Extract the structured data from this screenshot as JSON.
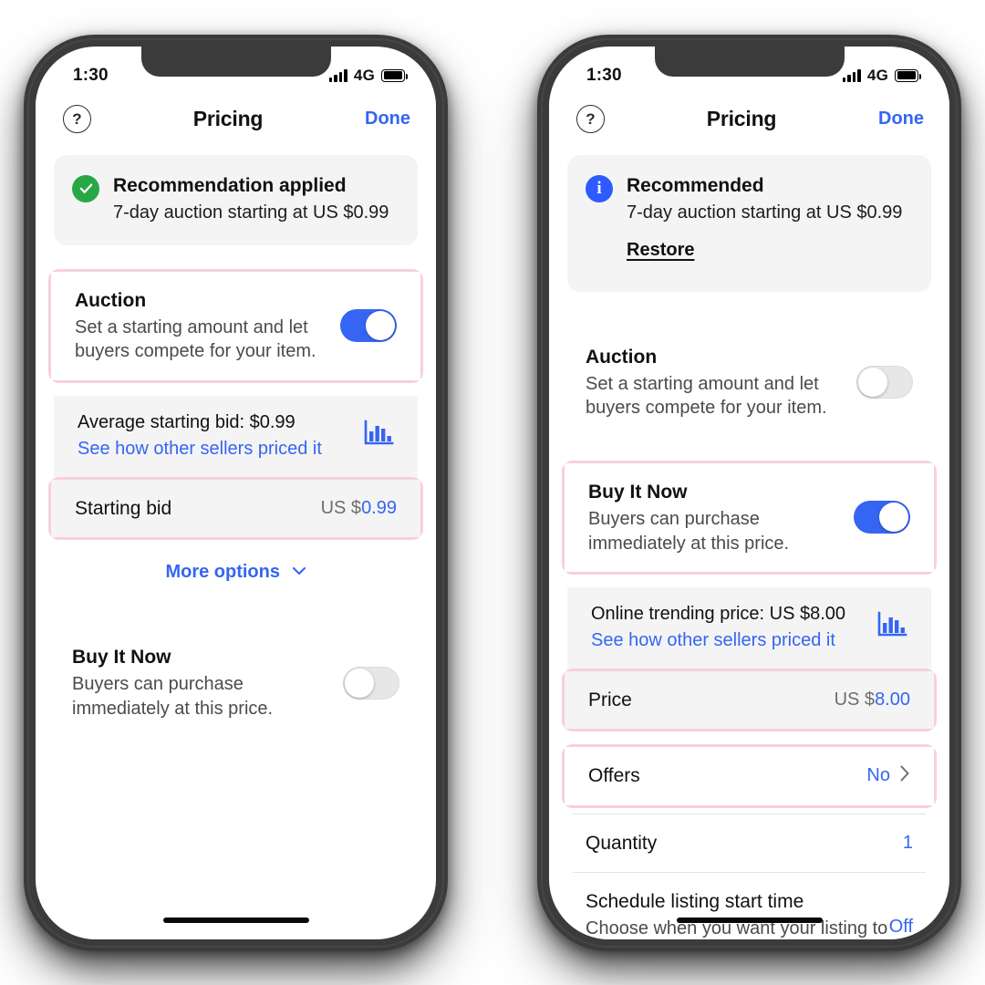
{
  "left_phone": {
    "status_bar": {
      "time": "1:30",
      "network": "4G",
      "signal_icon": "signal-bars-icon",
      "battery_icon": "battery-full-icon"
    },
    "nav": {
      "help_icon": "?",
      "title": "Pricing",
      "done_label": "Done"
    },
    "banner": {
      "icon": "check-circle-icon",
      "title": "Recommendation applied",
      "subtitle": "7-day auction starting at US $0.99"
    },
    "auction": {
      "title": "Auction",
      "subtitle": "Set a starting amount and let buyers compete for your item.",
      "toggle_state": "on"
    },
    "info": {
      "line1": "Average starting bid: $0.99",
      "line2": "See how other sellers priced it",
      "icon": "bar-chart-icon"
    },
    "starting_bid": {
      "label": "Starting bid",
      "currency": "US $",
      "value": "0.99"
    },
    "more_options": {
      "label": "More options",
      "icon": "chevron-down-icon"
    },
    "buy_it_now": {
      "title": "Buy It Now",
      "subtitle": "Buyers can purchase immediately at this price.",
      "toggle_state": "off"
    }
  },
  "right_phone": {
    "status_bar": {
      "time": "1:30",
      "network": "4G",
      "signal_icon": "signal-bars-icon",
      "battery_icon": "battery-full-icon"
    },
    "nav": {
      "help_icon": "?",
      "title": "Pricing",
      "done_label": "Done"
    },
    "banner": {
      "icon": "info-circle-icon",
      "title": "Recommended",
      "subtitle": "7-day auction starting at US $0.99",
      "restore_label": "Restore"
    },
    "auction": {
      "title": "Auction",
      "subtitle": "Set a starting amount and let buyers compete for your item.",
      "toggle_state": "off"
    },
    "buy_it_now": {
      "title": "Buy It Now",
      "subtitle": "Buyers can purchase immediately at this price.",
      "toggle_state": "on"
    },
    "info": {
      "line1": "Online trending price: US $8.00",
      "line2": "See how other sellers priced it",
      "icon": "bar-chart-icon"
    },
    "price": {
      "label": "Price",
      "currency": "US $",
      "value": "8.00"
    },
    "offers": {
      "label": "Offers",
      "value": "No",
      "icon": "chevron-right-icon"
    },
    "quantity": {
      "label": "Quantity",
      "value": "1"
    },
    "schedule": {
      "title": "Schedule listing start time",
      "subtitle": "Choose when you want your listing to appear on eBay.",
      "value": "Off"
    }
  },
  "colors": {
    "accent_blue": "#3665f3",
    "highlight_pink": "#f9cede",
    "success_green": "#2aa745",
    "info_blue": "#2d5bff",
    "panel_grey": "#f4f4f4"
  }
}
